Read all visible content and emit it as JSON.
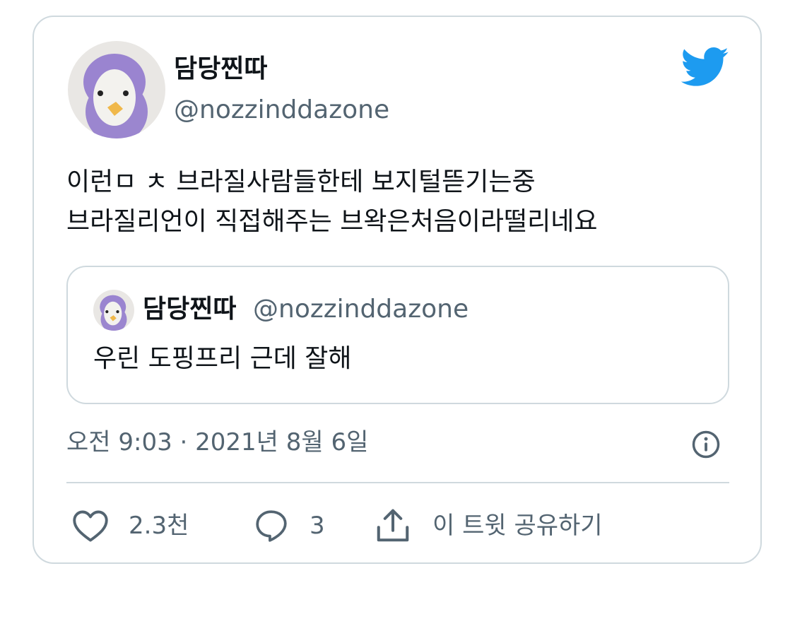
{
  "author": {
    "display_name": "담당찐따",
    "handle": "@nozzinddazone",
    "avatar_icon": "penguin-avatar-icon"
  },
  "brand_icon": "twitter-bird-icon",
  "brand_color": "#1d9bf0",
  "tweet": {
    "line1": "이런ㅁ ㅊ 브라질사람들한테 보지털뜯기는중",
    "line2": "브라질리언이 직접해주는 브왁은처음이라떨리네요"
  },
  "quoted_tweet": {
    "display_name": "담당찐따",
    "handle": "@nozzinddazone",
    "text": "우린 도핑프리 근데 잘해"
  },
  "timestamp": "오전 9:03 · 2021년 8월 6일",
  "actions": {
    "like_count": "2.3천",
    "reply_count": "3",
    "share_label": "이 트윗 공유하기"
  },
  "colors": {
    "text_primary": "#0f1419",
    "text_secondary": "#536471",
    "border": "#cfd9de"
  }
}
